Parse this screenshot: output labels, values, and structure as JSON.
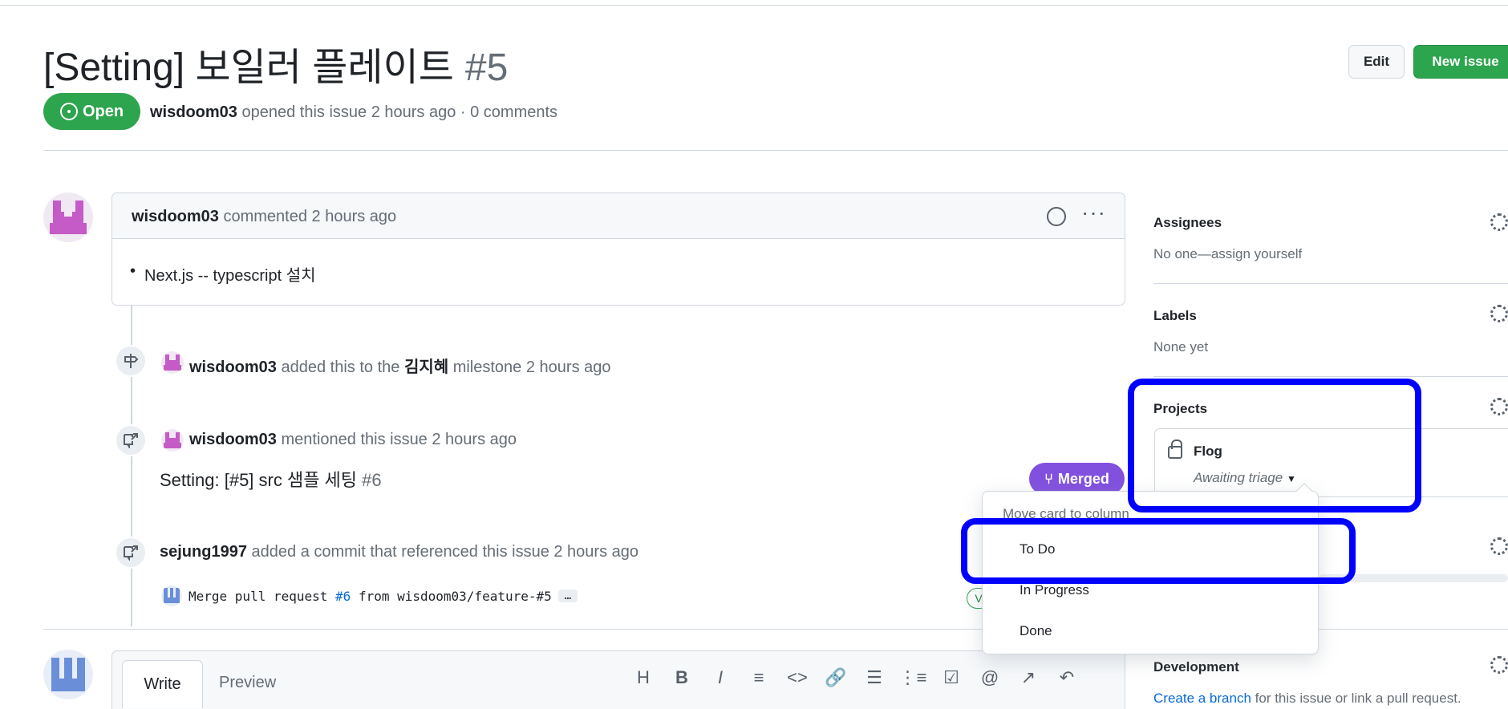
{
  "issue": {
    "title": "[Setting] 보일러 플레이트",
    "number": "#5",
    "state": "Open",
    "author": "wisdoom03",
    "meta_rest": "opened this issue 2 hours ago · 0 comments"
  },
  "header_buttons": {
    "edit": "Edit",
    "new_issue": "New issue"
  },
  "comment": {
    "author": "wisdoom03",
    "time": "commented 2 hours ago",
    "body": "Next.js -- typescript 설치"
  },
  "timeline": {
    "milestone": {
      "actor": "wisdoom03",
      "text1": "added this to the",
      "milestone": "김지혜",
      "text2": "milestone 2 hours ago"
    },
    "mention": {
      "actor": "wisdoom03",
      "text": "mentioned this issue 2 hours ago"
    },
    "pr": {
      "title": "Setting: [#5] src 샘플 세팅",
      "number": "#6",
      "badge": "Merged"
    },
    "commit_event": {
      "actor": "sejung1997",
      "text": "added a commit that referenced this issue 2 hours ago"
    },
    "commit": {
      "message_before": "Merge pull request",
      "ref": "#6",
      "message_after": "from wisdoom03/feature-#5",
      "ellipsis": "…",
      "verified_stub": "V"
    }
  },
  "editor": {
    "tab_write": "Write",
    "tab_preview": "Preview",
    "toolbar": [
      "H",
      "B",
      "I",
      "≡",
      "<>",
      "🔗",
      "☰",
      "⋮≡",
      "☑",
      "@",
      "↗",
      "↶"
    ]
  },
  "sidebar": {
    "assignees": {
      "title": "Assignees",
      "value": "No one—assign yourself"
    },
    "labels": {
      "title": "Labels",
      "value": "None yet"
    },
    "projects": {
      "title": "Projects",
      "name": "Flog",
      "status": "Awaiting triage"
    },
    "development": {
      "title": "Development",
      "link": "Create a branch",
      "rest": "for this issue or link a pull request."
    }
  },
  "dropdown": {
    "header": "Move card to column",
    "items": [
      "To Do",
      "In Progress",
      "Done"
    ]
  },
  "colors": {
    "open": "#2da44e",
    "merged": "#8250df",
    "highlight": "#0000ff",
    "link": "#0969da"
  }
}
